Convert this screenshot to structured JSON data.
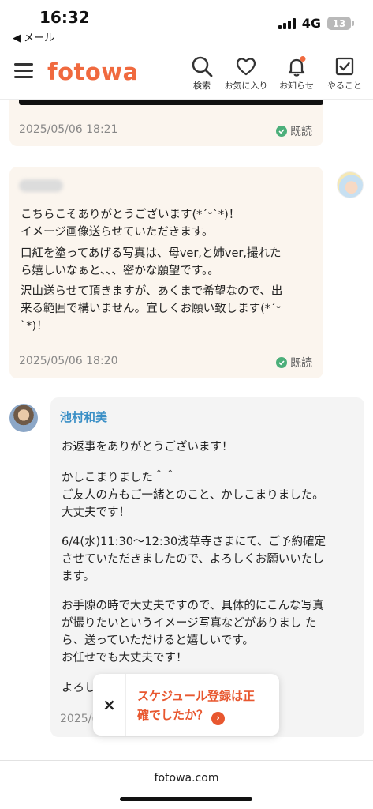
{
  "status_bar": {
    "time": "16:32",
    "back_label": "◀ メール",
    "network": "4G",
    "battery": "13"
  },
  "header": {
    "logo": "fotowa",
    "logo_color": "#f06a3f",
    "buttons": [
      {
        "label": "検索",
        "icon": "search-icon"
      },
      {
        "label": "お気に入り",
        "icon": "heart-icon"
      },
      {
        "label": "お知らせ",
        "icon": "bell-icon"
      },
      {
        "label": "やること",
        "icon": "checkbox-icon"
      }
    ]
  },
  "messages": [
    {
      "timestamp": "2025/05/06 18:21",
      "read_label": "既読"
    },
    {
      "sender": "user",
      "lines": [
        "こちらこそありがとうございます(*´ᵕ`*)！",
        "イメージ画像送らせていただきます。",
        "口紅を塗ってあげる写真は、母ver,と姉ver,撮れた",
        "ら嬉しいなぁと、、、密かな願望です。。",
        "沢山送らせて頂きますが、あくまで希望なので、出",
        "来る範囲で構いません。宜しくお願い致します(*´ᵕ",
        "`*)！"
      ],
      "timestamp": "2025/05/06 18:20",
      "read_label": "既読"
    },
    {
      "sender": "staff",
      "name": "池村和美",
      "paragraphs": [
        [
          "お返事をありがとうございます！"
        ],
        [
          "かしこまりました＾＾",
          "ご友人の方もご一緒とのこと、かしこまりました。",
          "大丈夫です！"
        ],
        [
          "6/4(水)11:30〜12:30浅草寺さまにて、ご予約確定",
          "させていただきましたので、よろしくお願いいたし",
          "ます。"
        ],
        [
          "お手隙の時で大丈夫ですので、具体的にこんな写真",
          "が撮りたいというイメージ写真などがありまし た",
          "ら、送っていただけると嬉しいです。",
          "お任せでも大丈夫です！"
        ],
        [
          "よろし"
        ]
      ],
      "timestamp_partial": "2025/("
    }
  ],
  "toast": {
    "close": "×",
    "text_line1": "スケジュール登録は正",
    "text_line2": "確でしたか？",
    "arrow": "›",
    "color": "#e8572f"
  },
  "footer": {
    "url": "fotowa.com"
  }
}
